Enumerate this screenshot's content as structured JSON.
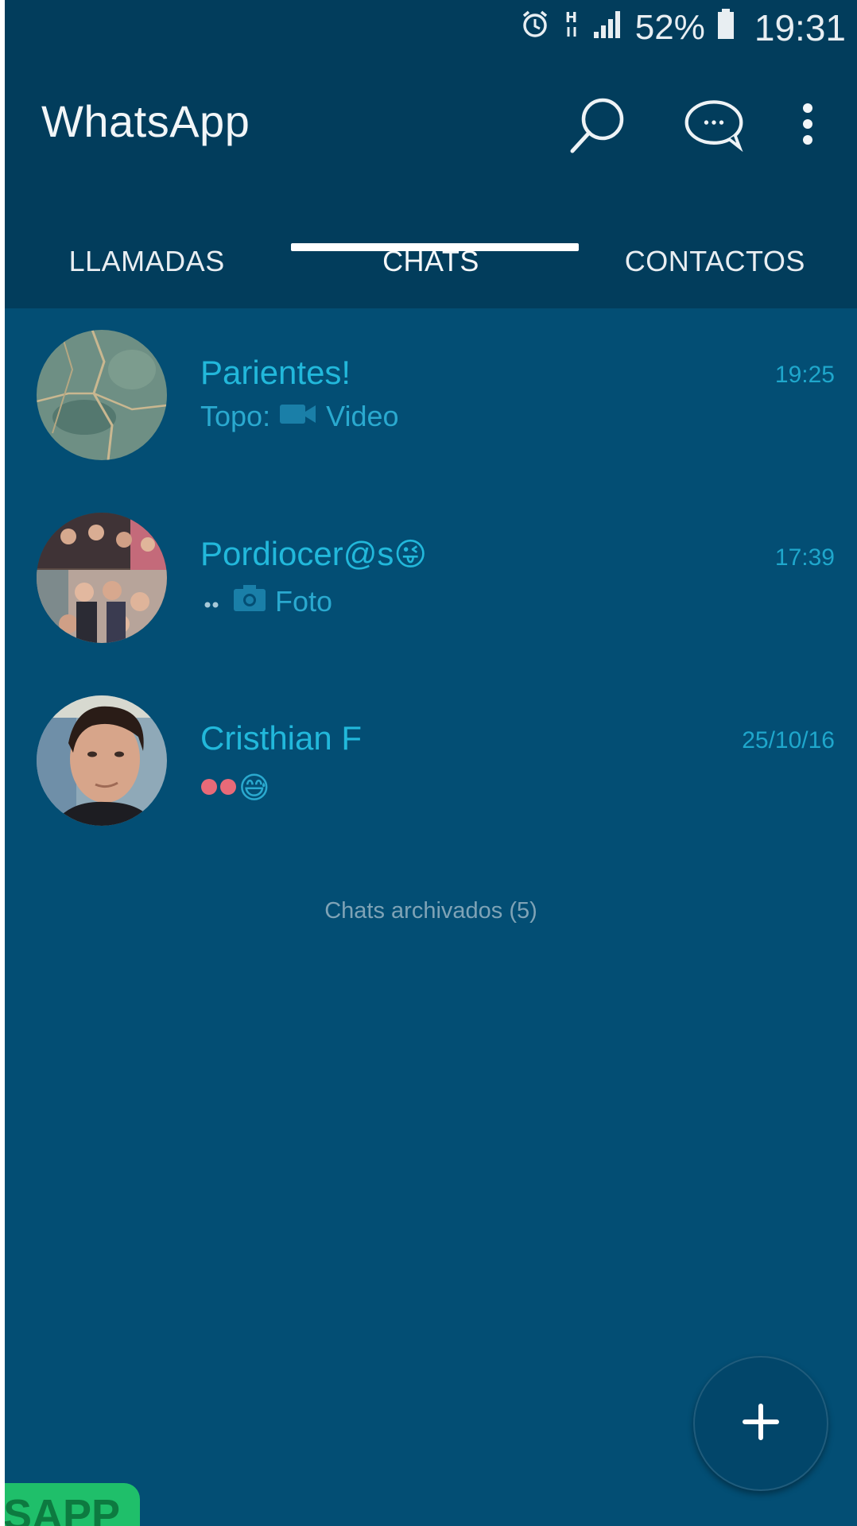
{
  "status_bar": {
    "battery": "52%",
    "time": "19:31",
    "icons": [
      "alarm-icon",
      "network-h-icon",
      "signal-icon",
      "battery-icon"
    ]
  },
  "app_bar": {
    "title": "WhatsApp",
    "actions": [
      "search-icon",
      "new-chat-icon",
      "more-options-icon"
    ]
  },
  "tabs": [
    {
      "label": "LLAMADAS",
      "active": false
    },
    {
      "label": "CHATS",
      "active": true
    },
    {
      "label": "CONTACTOS",
      "active": false
    }
  ],
  "chats": [
    {
      "name": "Parientes!",
      "time": "19:25",
      "sender": "Topo:",
      "media_label": "Video",
      "media_icon": "video-icon"
    },
    {
      "name": "Pordiocer@s",
      "name_emoji": "😜",
      "time": "17:39",
      "media_label": "Foto",
      "media_icon": "camera-icon"
    },
    {
      "name": "Cristhian F",
      "time": "25/10/16",
      "preview_emoji": "😅"
    }
  ],
  "archived": "Chats archivados (5)",
  "fab": {
    "icon": "plus-icon"
  },
  "promo_badge": "SAPP",
  "colors": {
    "appbar": "#023d5c",
    "background": "#034e74",
    "accent_text": "#22b8db",
    "fab": "#02466a"
  }
}
